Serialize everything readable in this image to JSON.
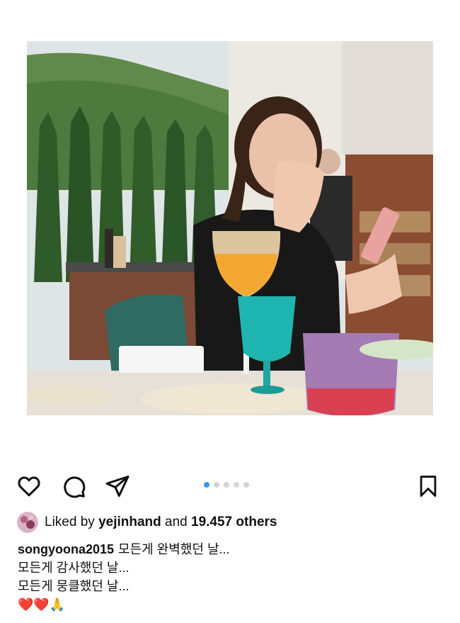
{
  "post": {
    "image_alt": "photo",
    "carousel": {
      "total": 5,
      "active": 1
    }
  },
  "icons": {
    "like": "heart-icon",
    "comment": "comment-bubble-icon",
    "share": "paper-plane-icon",
    "save": "bookmark-icon"
  },
  "likes": {
    "prefix": "Liked by",
    "user": "yejinhand",
    "middle": "and",
    "others": "19.457 others"
  },
  "caption": {
    "username": "songyoona2015",
    "first_line": "모든게 완벽했던 날...",
    "lines": [
      "모든게 감사했던 날...",
      "모든게 뭉클했던 날..."
    ],
    "emoji_line": "❤️❤️🙏"
  },
  "colors": {
    "accent": "#3897f0",
    "text": "#111111",
    "dot_inactive": "#d4d4d4"
  }
}
